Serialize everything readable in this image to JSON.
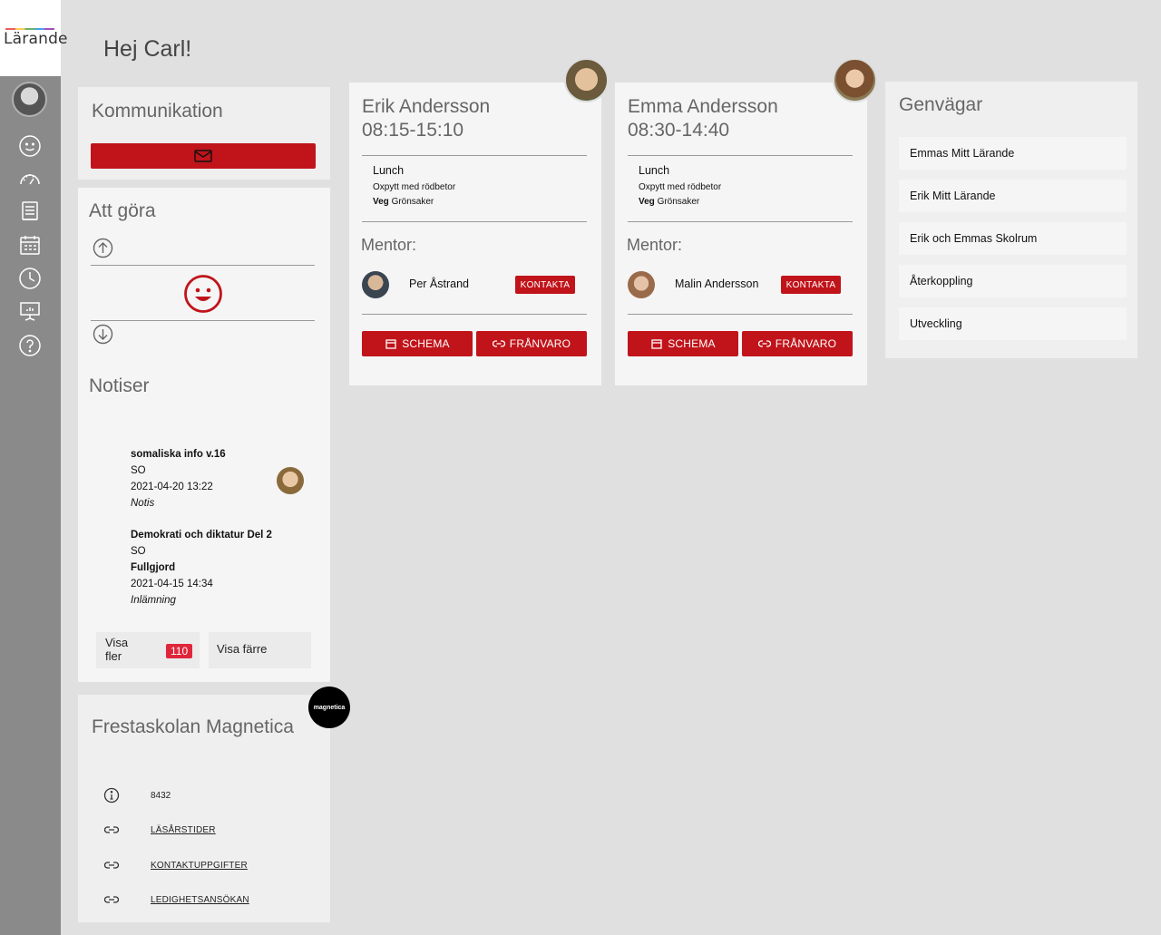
{
  "app": {
    "logo": "Lärande"
  },
  "greeting": "Hej Carl!",
  "kommunikation": {
    "title": "Kommunikation"
  },
  "att_gora": {
    "title": "Att göra"
  },
  "notiser": {
    "title": "Notiser",
    "items": [
      {
        "title": "somaliska info v.16",
        "subject": "SO",
        "date": "2021-04-20 13:22",
        "type": "Notis"
      },
      {
        "title": "Demokrati och diktatur Del 2",
        "subject": "SO",
        "status": "Fullgjord",
        "date": "2021-04-15 14:34",
        "type": "Inlämning"
      }
    ],
    "visa_fler": "Visa fler",
    "visa_fler_count": "110",
    "visa_farre": "Visa färre"
  },
  "skola": {
    "title": "Frestaskolan Magnetica",
    "logo_text": "magnetica",
    "info_number": "8432",
    "links": [
      "LÄSÅRSTIDER",
      "KONTAKTUPPGIFTER",
      "LEDIGHETSANSÖKAN"
    ]
  },
  "children": [
    {
      "name": "Erik Andersson",
      "time": "08:15-15:10",
      "lunch_title": "Lunch",
      "lunch_main": "Oxpytt med rödbetor",
      "lunch_veg_label": "Veg",
      "lunch_veg": "Grönsaker",
      "mentor_title": "Mentor:",
      "mentor_name": "Per Åstrand",
      "kontakta": "KONTAKTA",
      "schema": "SCHEMA",
      "franvaro": "FRÅNVARO"
    },
    {
      "name": "Emma Andersson",
      "time": "08:30-14:40",
      "lunch_title": "Lunch",
      "lunch_main": "Oxpytt med rödbetor",
      "lunch_veg_label": "Veg",
      "lunch_veg": "Grönsaker",
      "mentor_title": "Mentor:",
      "mentor_name": "Malin Andersson",
      "kontakta": "KONTAKTA",
      "schema": "SCHEMA",
      "franvaro": "FRÅNVARO"
    }
  ],
  "genvagar": {
    "title": "Genvägar",
    "items": [
      "Emmas Mitt Lärande",
      "Erik Mitt Lärande",
      "Erik och Emmas Skolrum",
      "Återkoppling",
      "Utveckling"
    ]
  },
  "colors": {
    "accent": "#c0141a",
    "badge": "#e0263a",
    "sidebar": "#8a8a8a"
  },
  "icons": [
    "smile-icon",
    "dashboard-icon",
    "book-icon",
    "calendar-icon",
    "clock-icon",
    "presentation-icon",
    "help-icon",
    "mail-icon",
    "arrow-up-icon",
    "arrow-down-icon",
    "info-icon",
    "link-icon"
  ]
}
